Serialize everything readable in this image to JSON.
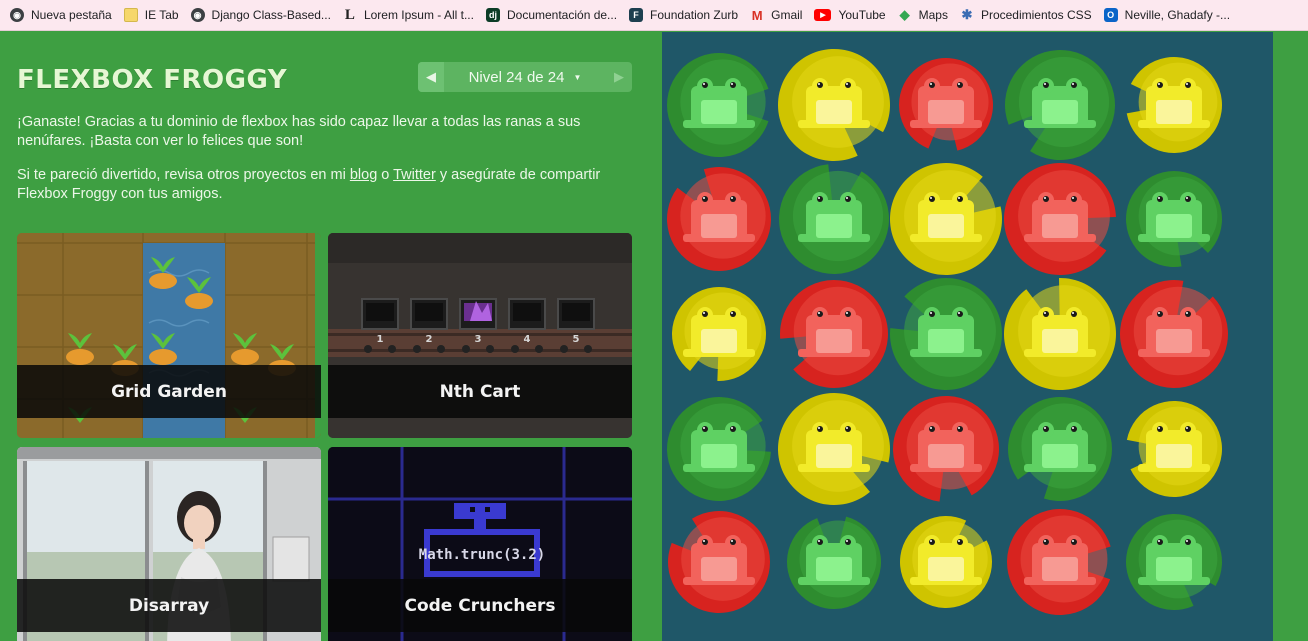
{
  "bookmarks": [
    {
      "label": "Nueva pestaña",
      "icon": "globe-icon",
      "color": "#5f6368"
    },
    {
      "label": "IE Tab",
      "icon": "folder-icon",
      "color": "#f5c518"
    },
    {
      "label": "Django Class-Based...",
      "icon": "globe-icon",
      "color": "#5f6368"
    },
    {
      "label": "Lorem Ipsum - All t...",
      "icon": "lipsum-icon",
      "color": "#222222"
    },
    {
      "label": "Documentación de...",
      "icon": "django-icon",
      "color": "#0c3c26"
    },
    {
      "label": "Foundation Zurb",
      "icon": "foundation-icon",
      "color": "#1d3f4f"
    },
    {
      "label": "Gmail",
      "icon": "gmail-icon",
      "color": "#d93025"
    },
    {
      "label": "YouTube",
      "icon": "youtube-icon",
      "color": "#ff0000"
    },
    {
      "label": "Maps",
      "icon": "maps-icon",
      "color": "#34a853"
    },
    {
      "label": "Procedimientos CSS",
      "icon": "gear-icon",
      "color": "#3b6cb3"
    },
    {
      "label": "Neville, Ghadafy -...",
      "icon": "outlook-icon",
      "color": "#0a64c8"
    }
  ],
  "header": {
    "title": "FLEXBOX FROGGY",
    "level_text": "Nivel 24 de 24",
    "prev_icon": "◀",
    "next_icon": "▶",
    "caret": "▼"
  },
  "message": {
    "win": "¡Ganaste! Gracias a tu dominio de flexbox has sido capaz llevar a todas las ranas a sus nenúfares. ¡Basta con ver lo felices que son!",
    "share_prefix": "Si te pareció divertido, revisa otros proyectos en mi ",
    "blog_link": "blog",
    "share_or": " o ",
    "twitter_link": "Twitter",
    "share_suffix": " y asegúrate de compartir Flexbox Froggy con tus amigos."
  },
  "games": [
    {
      "name": "Grid Garden"
    },
    {
      "name": "Nth Cart",
      "cart_numbers": [
        "1",
        "2",
        "3",
        "4",
        "5"
      ]
    },
    {
      "name": "Disarray"
    },
    {
      "name": "Code Crunchers",
      "code": "Math.trunc(3.2)"
    }
  ],
  "pond": {
    "colors": {
      "red": {
        "pad": "#d7231f",
        "padLight": "#e94a3f",
        "frog": "#f2635c",
        "belly": "#f79a93"
      },
      "green": {
        "pad": "#2e8c2f",
        "padLight": "#3da43e",
        "frog": "#5fd163",
        "belly": "#8cf28d"
      },
      "yellow": {
        "pad": "#cfc400",
        "padLight": "#e3d716",
        "frog": "#f2eb2a",
        "belly": "#faf59b"
      }
    },
    "rows": [
      [
        "green",
        "yellow",
        "red",
        "green",
        "yellow"
      ],
      [
        "red",
        "green",
        "yellow",
        "red",
        "green"
      ],
      [
        "yellow",
        "red",
        "green",
        "yellow",
        "red"
      ],
      [
        "green",
        "yellow",
        "red",
        "green",
        "yellow"
      ],
      [
        "red",
        "green",
        "yellow",
        "red",
        "green"
      ]
    ]
  }
}
